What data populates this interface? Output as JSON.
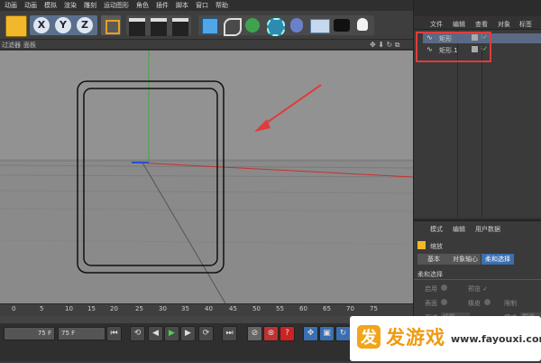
{
  "menu": [
    "动画",
    "动画",
    "模拟",
    "渲染",
    "雕刻",
    "运动图形",
    "角色",
    "插件",
    "脚本",
    "窗口",
    "帮助"
  ],
  "toolbar": {
    "axes": [
      "X",
      "Y",
      "Z"
    ]
  },
  "viewport_header": {
    "left": "过滤器",
    "right": "面板"
  },
  "right_menu": [
    "文件",
    "编辑",
    "查看",
    "对象",
    "标签"
  ],
  "objects": [
    {
      "name": "矩形"
    },
    {
      "name": "矩形.1"
    }
  ],
  "attr_menu": [
    "模式",
    "编辑",
    "用户数据"
  ],
  "attr_title": "缩放",
  "attr_tabs": [
    "基本",
    "对象轴心",
    "柔和选择"
  ],
  "attr_section": "柔和选择",
  "attr_rows": [
    {
      "a": "启用",
      "b": "预览 ✓"
    },
    {
      "a": "表面",
      "b": "橡皮",
      "c": "限制"
    },
    {
      "a": "衰减",
      "b": "线性",
      "c": "模式",
      "d": "群组"
    }
  ],
  "timeline_ticks": [
    "0",
    "5",
    "10",
    "15",
    "20",
    "25",
    "30",
    "35",
    "40",
    "45",
    "50",
    "55",
    "60",
    "65",
    "70",
    "75"
  ],
  "frame_left": "75 F",
  "frame_right": "75 F",
  "watermark": {
    "brand": "发游戏",
    "url": "www.fayouxi.com"
  },
  "colors": {
    "accent": "#e03c3c",
    "highlight": "#3b6fb0",
    "yellow": "#f2b72a"
  }
}
